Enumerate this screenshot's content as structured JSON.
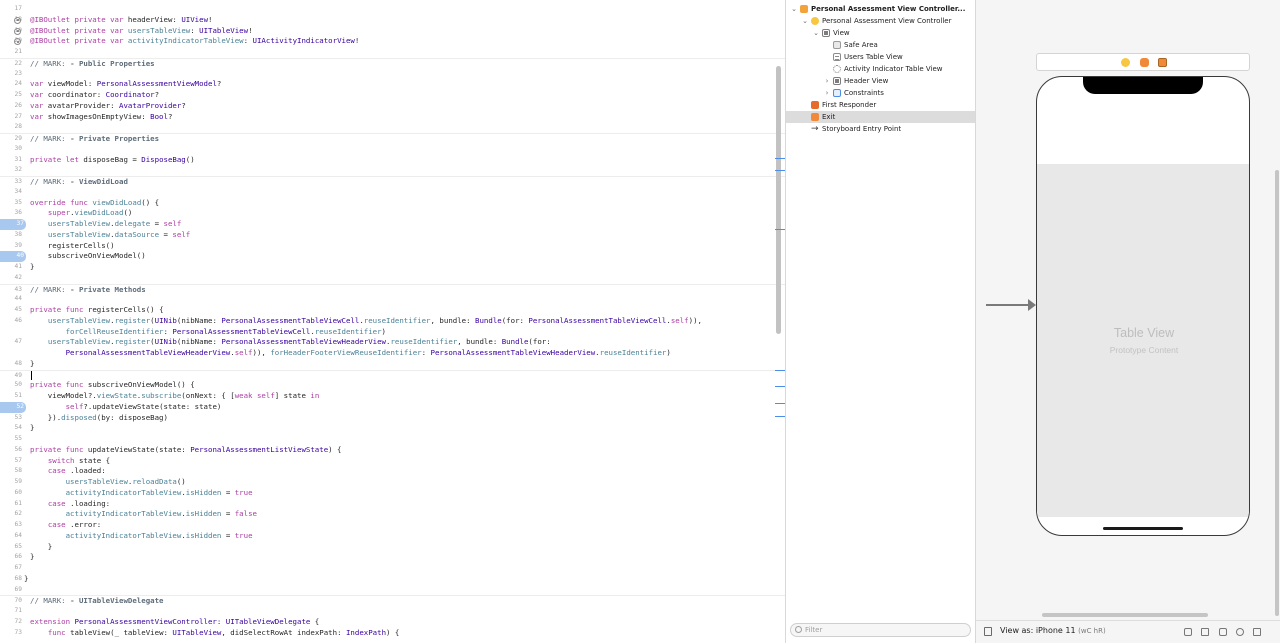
{
  "editor": {
    "lines": [
      {
        "n": "17",
        "text": ""
      },
      {
        "n": "18",
        "text": "@IBOutlet private var headerView: UIView!",
        "outlet": true
      },
      {
        "n": "19",
        "text": "@IBOutlet private var usersTableView: UITableView!",
        "outlet": true
      },
      {
        "n": "20",
        "text": "@IBOutlet private var activityIndicatorTableView: UIActivityIndicatorView!",
        "outlet": true
      },
      {
        "n": "21",
        "text": ""
      },
      {
        "n": "22",
        "text": "// MARK: - Public Properties",
        "sep": true
      },
      {
        "n": "23",
        "text": ""
      },
      {
        "n": "24",
        "text": "var viewModel: PersonalAssessmentViewModel?"
      },
      {
        "n": "25",
        "text": "var coordinator: Coordinator?"
      },
      {
        "n": "26",
        "text": "var avatarProvider: AvatarProvider?"
      },
      {
        "n": "27",
        "text": "var showImagesOnEmptyView: Bool?"
      },
      {
        "n": "28",
        "text": ""
      },
      {
        "n": "29",
        "text": "// MARK: - Private Properties",
        "sep": true
      },
      {
        "n": "30",
        "text": ""
      },
      {
        "n": "31",
        "text": "private let disposeBag = DisposeBag()"
      },
      {
        "n": "32",
        "text": ""
      },
      {
        "n": "33",
        "text": "// MARK: - ViewDidLoad",
        "sep": true
      },
      {
        "n": "34",
        "text": ""
      },
      {
        "n": "35",
        "text": "override func viewDidLoad() {"
      },
      {
        "n": "36",
        "text": "    super.viewDidLoad()"
      },
      {
        "n": "37",
        "text": "    usersTableView.delegate = self",
        "bp": true
      },
      {
        "n": "38",
        "text": "    usersTableView.dataSource = self"
      },
      {
        "n": "39",
        "text": "    registerCells()"
      },
      {
        "n": "40",
        "text": "    subscriveOnViewModel()",
        "bp": true
      },
      {
        "n": "41",
        "text": "}"
      },
      {
        "n": "42",
        "text": ""
      },
      {
        "n": "43",
        "text": "// MARK: - Private Methods",
        "sep": true
      },
      {
        "n": "44",
        "text": ""
      },
      {
        "n": "45",
        "text": "private func registerCells() {"
      },
      {
        "n": "46",
        "text": "    usersTableView.register(UINib(nibName: PersonalAssessmentTableViewCell.reuseIdentifier, bundle: Bundle(for: PersonalAssessmentTableViewCell.self)),"
      },
      {
        "n": "",
        "text": "        forCellReuseIdentifier: PersonalAssessmentTableViewCell.reuseIdentifier)"
      },
      {
        "n": "47",
        "text": "    usersTableView.register(UINib(nibName: PersonalAssessmentTableViewHeaderView.reuseIdentifier, bundle: Bundle(for:"
      },
      {
        "n": "",
        "text": "        PersonalAssessmentTableViewHeaderView.self)), forHeaderFooterViewReuseIdentifier: PersonalAssessmentTableViewHeaderView.reuseIdentifier)"
      },
      {
        "n": "48",
        "text": "}"
      },
      {
        "n": "49",
        "text": "",
        "caret": true,
        "sep": true
      },
      {
        "n": "50",
        "text": "private func subscriveOnViewModel() {"
      },
      {
        "n": "51",
        "text": "    viewModel?.viewState.subscribe(onNext: { [weak self] state in"
      },
      {
        "n": "52",
        "text": "        self?.updateViewState(state: state)",
        "bp": true
      },
      {
        "n": "53",
        "text": "    }).disposed(by: disposeBag)"
      },
      {
        "n": "54",
        "text": "}"
      },
      {
        "n": "55",
        "text": ""
      },
      {
        "n": "56",
        "text": "private func updateViewState(state: PersonalAssessmentListViewState) {"
      },
      {
        "n": "57",
        "text": "    switch state {"
      },
      {
        "n": "58",
        "text": "    case .loaded:"
      },
      {
        "n": "59",
        "text": "        usersTableView.reloadData()"
      },
      {
        "n": "60",
        "text": "        activityIndicatorTableView.isHidden = true"
      },
      {
        "n": "61",
        "text": "    case .loading:"
      },
      {
        "n": "62",
        "text": "        activityIndicatorTableView.isHidden = false"
      },
      {
        "n": "63",
        "text": "    case .error:"
      },
      {
        "n": "64",
        "text": "        activityIndicatorTableView.isHidden = true"
      },
      {
        "n": "65",
        "text": "    }"
      },
      {
        "n": "66",
        "text": "}"
      },
      {
        "n": "67",
        "text": ""
      },
      {
        "n": "68",
        "text": "}",
        "outdent": 1
      },
      {
        "n": "69",
        "text": ""
      },
      {
        "n": "70",
        "text": "// MARK: - UITableViewDelegate",
        "sep": true,
        "outdent": 2
      },
      {
        "n": "71",
        "text": ""
      },
      {
        "n": "72",
        "text": "extension PersonalAssessmentViewController: UITableViewDelegate {",
        "outdent": 2
      },
      {
        "n": "73",
        "text": "    func tableView(_ tableView: UITableView, didSelectRowAt indexPath: IndexPath) {",
        "outdent": 2
      }
    ],
    "keywords": [
      "override",
      "private",
      "extension",
      "switch",
      "return",
      "super",
      "self",
      "func",
      "case",
      "true",
      "false",
      "weak",
      "let",
      "var",
      "in"
    ],
    "types": [
      "PersonalAssessmentTableViewHeaderView",
      "PersonalAssessmentTableViewCell",
      "PersonalAssessmentListViewState",
      "PersonalAssessmentViewController",
      "PersonalAssessmentViewModel",
      "UIActivityIndicatorView",
      "UITableViewDelegate",
      "AvatarProvider",
      "UITableView",
      "Coordinator",
      "DisposeBag",
      "IndexPath",
      "UIView",
      "Bundle",
      "UINib",
      "Bool"
    ],
    "props": [
      "activityIndicatorTableView",
      "forHeaderFooterViewReuseIdentifier",
      "forCellReuseIdentifier",
      "reuseIdentifier",
      "usersTableView",
      "viewDidLoad",
      "reloadData",
      "dataSource",
      "viewState",
      "subscribe",
      "disposed",
      "isHidden",
      "delegate",
      "register"
    ]
  },
  "outline": {
    "items": [
      {
        "label": "Personal Assessment View Controller...",
        "icon": "scene",
        "depth": 0,
        "disclosure": "open",
        "bold": true
      },
      {
        "label": "Personal Assessment View Controller",
        "icon": "vc",
        "depth": 1,
        "disclosure": "open"
      },
      {
        "label": "View",
        "icon": "view",
        "depth": 2,
        "disclosure": "open"
      },
      {
        "label": "Safe Area",
        "icon": "safe",
        "depth": 3
      },
      {
        "label": "Users Table View",
        "icon": "table",
        "depth": 3
      },
      {
        "label": "Activity Indicator Table View",
        "icon": "spin",
        "depth": 3
      },
      {
        "label": "Header View",
        "icon": "view",
        "depth": 3,
        "disclosure": "closed"
      },
      {
        "label": "Constraints",
        "icon": "cons",
        "depth": 3,
        "disclosure": "closed"
      },
      {
        "label": "First Responder",
        "icon": "responder",
        "depth": 1
      },
      {
        "label": "Exit",
        "icon": "exit",
        "depth": 1,
        "selected": true
      },
      {
        "label": "Storyboard Entry Point",
        "icon": "arrow",
        "depth": 1
      }
    ],
    "arrow_glyph": "→",
    "filter_placeholder": "Filter"
  },
  "canvas": {
    "table_title": "Table View",
    "table_subtitle": "Prototype Content",
    "view_as": "View as: iPhone 11",
    "view_as_traits": "(wC hR)"
  },
  "colors": {
    "breakpoint": "#a8c8ef",
    "keyword": "#ad3da4",
    "type": "#3900a0",
    "property": "#4b8196",
    "comment": "#5d6c79",
    "scene_icon": "#f2a33c",
    "selection": "#dcdcdc"
  }
}
